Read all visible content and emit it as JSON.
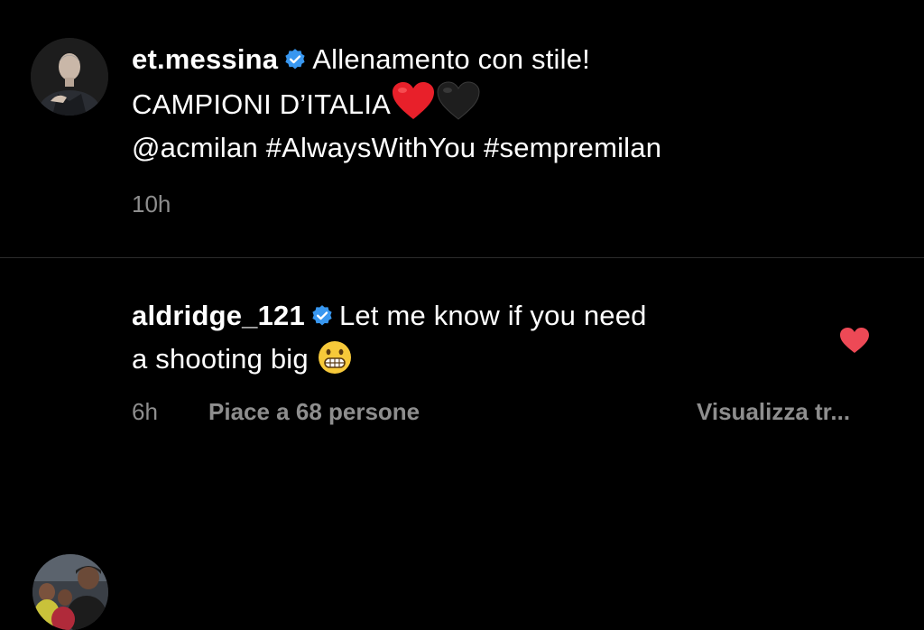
{
  "post": {
    "username": "et.messina",
    "caption_line1": "Allenamento con stile!",
    "caption_line2": "CAMPIONI D’ITALIA",
    "caption_line3": "@acmilan #AlwaysWithYou #sempremilan",
    "timestamp": "10h",
    "emoji_icons": [
      "red-heart-icon",
      "black-heart-icon"
    ]
  },
  "comment": {
    "username": "aldridge_121",
    "text_line1": "Let me know if you need",
    "text_line2": "a shooting big",
    "emoji_icon": "grimacing-face-icon",
    "timestamp": "6h",
    "likes_label": "Piace a 68 persone",
    "translate_label": "Visualizza tr..."
  },
  "colors": {
    "background": "#000000",
    "text": "#ffffff",
    "meta_text": "#8e8e8e",
    "verified_badge": "#3897f0",
    "like_heart": "#ed4956",
    "divider": "#2b2b2b"
  }
}
